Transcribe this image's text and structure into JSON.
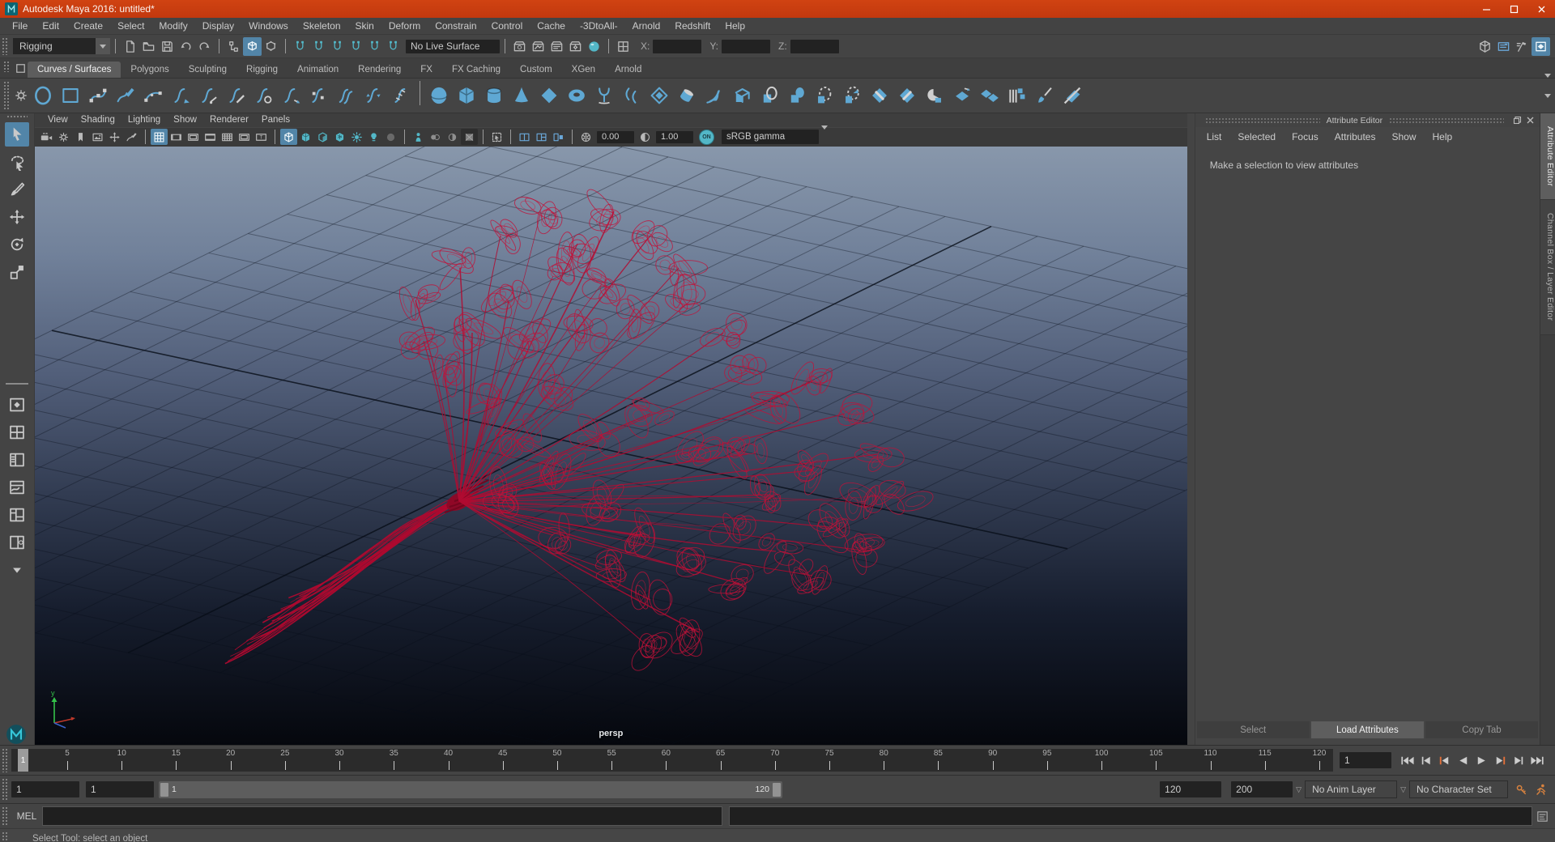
{
  "title_bar": {
    "title": "Autodesk Maya 2016: untitled*"
  },
  "menu_bar": {
    "items": [
      "File",
      "Edit",
      "Create",
      "Select",
      "Modify",
      "Display",
      "Windows",
      "Skeleton",
      "Skin",
      "Deform",
      "Constrain",
      "Control",
      "Cache",
      "-3DtoAll-",
      "Arnold",
      "Redshift",
      "Help"
    ]
  },
  "status_line": {
    "menuset_value": "Rigging",
    "live_surface_value": "No Live Surface",
    "x_label": "X:",
    "y_label": "Y:",
    "z_label": "Z:",
    "icons_file": [
      {
        "name": "new-scene-icon",
        "glyph": "file"
      },
      {
        "name": "open-scene-icon",
        "glyph": "folder"
      },
      {
        "name": "save-scene-icon",
        "glyph": "save"
      },
      {
        "name": "undo-icon",
        "glyph": "undo"
      },
      {
        "name": "redo-icon",
        "glyph": "redo"
      }
    ],
    "icons_selection": [
      {
        "name": "select-by-hierarchy-icon",
        "glyph": "selHier"
      },
      {
        "name": "select-by-object-type-icon",
        "glyph": "selObj",
        "active": true
      },
      {
        "name": "select-by-component-type-icon",
        "glyph": "selComp"
      }
    ],
    "icons_snap": [
      {
        "name": "snap-to-grid-icon",
        "glyph": "magnet",
        "tone": "teal"
      },
      {
        "name": "snap-to-curve-icon",
        "glyph": "magnet",
        "tone": "teal"
      },
      {
        "name": "snap-to-point-icon",
        "glyph": "magnet",
        "tone": "teal"
      },
      {
        "name": "snap-to-projected-center-icon",
        "glyph": "magnet",
        "tone": "teal"
      },
      {
        "name": "snap-to-view-plane-icon",
        "glyph": "magnet",
        "tone": "teal"
      },
      {
        "name": "make-object-live-icon",
        "glyph": "magnet",
        "tone": "teal"
      }
    ],
    "icons_render": [
      {
        "name": "open-render-view-icon",
        "glyph": "renderA"
      },
      {
        "name": "render-current-frame-icon",
        "glyph": "renderB"
      },
      {
        "name": "ipr-render-icon",
        "glyph": "renderC"
      },
      {
        "name": "render-settings-icon",
        "glyph": "renderD"
      },
      {
        "name": "display-render-settings-icon",
        "glyph": "tealSphere",
        "tone": "teal"
      }
    ],
    "icons_xyz": [
      {
        "name": "coordinate-input-mode-icon",
        "glyph": "xyzbox"
      }
    ],
    "icons_sidebar": [
      {
        "name": "modeling-toolkit-icon",
        "glyph": "cubeBig"
      },
      {
        "name": "humanik-icon",
        "glyph": "panelIcon",
        "tone": "blueline"
      },
      {
        "name": "tool-settings-icon",
        "glyph": "hammer"
      },
      {
        "name": "channel-box-icon",
        "glyph": "envelopeBox",
        "active": true
      }
    ]
  },
  "shelf": {
    "tabs": [
      {
        "label": "Curves / Surfaces",
        "active": true
      },
      {
        "label": "Polygons"
      },
      {
        "label": "Sculpting"
      },
      {
        "label": "Rigging"
      },
      {
        "label": "Animation"
      },
      {
        "label": "Rendering"
      },
      {
        "label": "FX"
      },
      {
        "label": "FX Caching"
      },
      {
        "label": "Custom"
      },
      {
        "label": "XGen"
      },
      {
        "label": "Arnold"
      }
    ],
    "icons": [
      {
        "name": "nurbs-circle-icon",
        "glyph": "shelfcircle"
      },
      {
        "name": "nurbs-square-icon",
        "glyph": "shelfsquare"
      },
      {
        "name": "cv-curve-tool-icon",
        "glyph": "cvcurve"
      },
      {
        "name": "pencil-curve-tool-icon",
        "glyph": "pencilcurve"
      },
      {
        "name": "three-point-arc-icon",
        "glyph": "arc3"
      },
      {
        "name": "attach-curves-icon",
        "glyph": "scurveA"
      },
      {
        "name": "detach-curves-icon",
        "glyph": "scurveCut"
      },
      {
        "name": "cut-curve-icon",
        "glyph": "scurveSlash"
      },
      {
        "name": "open-close-curve-icon",
        "glyph": "scurveO"
      },
      {
        "name": "extend-curve-icon",
        "glyph": "scurveArr"
      },
      {
        "name": "insert-knot-icon",
        "glyph": "scurvePts"
      },
      {
        "name": "offset-curve-icon",
        "glyph": "scurveDbl"
      },
      {
        "name": "reverse-curve-icon",
        "glyph": "scurveRev"
      },
      {
        "name": "rebuild-curve-icon",
        "glyph": "scurveHatch"
      },
      {
        "glyph": "|"
      },
      {
        "name": "nurbs-sphere-icon",
        "glyph": "sphereP"
      },
      {
        "name": "nurbs-cube-icon",
        "glyph": "cubeP"
      },
      {
        "name": "nurbs-cylinder-icon",
        "glyph": "cylP"
      },
      {
        "name": "nurbs-cone-icon",
        "glyph": "coneP"
      },
      {
        "name": "nurbs-plane-icon",
        "glyph": "planeP"
      },
      {
        "name": "nurbs-torus-icon",
        "glyph": "torusP"
      },
      {
        "name": "revolve-icon",
        "glyph": "revolveP"
      },
      {
        "name": "loft-icon",
        "glyph": "loftP"
      },
      {
        "name": "planar-icon",
        "glyph": "planarP"
      },
      {
        "name": "extrude-icon",
        "glyph": "tubeP"
      },
      {
        "name": "birail-icon",
        "glyph": "birailP"
      },
      {
        "name": "bevel-plus-icon",
        "glyph": "extrudeP"
      },
      {
        "name": "project-curve-icon",
        "glyph": "surfcirc1"
      },
      {
        "name": "intersect-surfaces-icon",
        "glyph": "surfcirc2"
      },
      {
        "name": "trim-tool-icon",
        "glyph": "projdash"
      },
      {
        "name": "untrim-surfaces-icon",
        "glyph": "projdash2"
      },
      {
        "name": "attach-surfaces-icon",
        "glyph": "trimdiamond"
      },
      {
        "name": "detach-surfaces-icon",
        "glyph": "trimdiamond2"
      },
      {
        "name": "open-close-surfaces-icon",
        "glyph": "pacmancyl"
      },
      {
        "name": "insert-isoparms-icon",
        "glyph": "arrowdiamond"
      },
      {
        "name": "extend-surfaces-icon",
        "glyph": "diamondpair"
      },
      {
        "name": "rebuild-surfaces-icon",
        "glyph": "barcubes"
      },
      {
        "name": "sculpt-surfaces-tool-icon",
        "glyph": "brushsurf"
      },
      {
        "name": "cut-surfaces-icon",
        "glyph": "slashdiamond"
      }
    ]
  },
  "toolbox": {
    "tools": [
      {
        "name": "select-tool-icon",
        "glyph": "cursor",
        "active": true
      },
      {
        "name": "lasso-select-tool-icon",
        "glyph": "lasso"
      },
      {
        "name": "paint-select-tool-icon",
        "glyph": "brush"
      },
      {
        "name": "move-tool-icon",
        "glyph": "move"
      },
      {
        "name": "rotate-tool-icon",
        "glyph": "rotate"
      },
      {
        "name": "scale-tool-icon",
        "glyph": "scale"
      }
    ],
    "layouts": [
      {
        "name": "layout-single-pane-icon",
        "glyph": "pane1"
      },
      {
        "name": "layout-four-pane-icon",
        "glyph": "pane4"
      },
      {
        "name": "layout-persp-outliner-icon",
        "glyph": "paneOutliner"
      },
      {
        "name": "layout-persp-graph-icon",
        "glyph": "paneGraph"
      },
      {
        "name": "layout-hypershade-icon",
        "glyph": "paneHyper"
      },
      {
        "name": "layout-persp-uv-icon",
        "glyph": "paneUV"
      },
      {
        "name": "layout-more-icon",
        "glyph": "dropdown"
      }
    ]
  },
  "viewport": {
    "menus": [
      "View",
      "Shading",
      "Lighting",
      "Show",
      "Renderer",
      "Panels"
    ],
    "toolbar": [
      {
        "name": "select-camera-icon",
        "glyph": "camera"
      },
      {
        "name": "camera-attributes-icon",
        "glyph": "gear"
      },
      {
        "name": "bookmark-icon",
        "glyph": "bookmark"
      },
      {
        "name": "image-plane-icon",
        "glyph": "imgplane"
      },
      {
        "name": "two-d-pan-zoom-icon",
        "glyph": "move"
      },
      {
        "name": "greasepencil-icon",
        "glyph": "pencilcurve"
      },
      {
        "glyph": "|"
      },
      {
        "name": "grid-toggle-icon",
        "glyph": "grid9",
        "active": true
      },
      {
        "name": "film-gate-icon",
        "glyph": "film"
      },
      {
        "name": "resolution-gate-icon",
        "glyph": "resgate"
      },
      {
        "name": "gate-mask-icon",
        "glyph": "gatemask"
      },
      {
        "name": "field-chart-icon",
        "glyph": "fieldchart"
      },
      {
        "name": "safe-action-icon",
        "glyph": "safeaction"
      },
      {
        "name": "safe-title-icon",
        "glyph": "safetitle"
      },
      {
        "glyph": "|"
      },
      {
        "name": "wireframe-display-icon",
        "glyph": "wirecube",
        "tone": "teal",
        "active": true
      },
      {
        "name": "shaded-display-icon",
        "glyph": "shadecube",
        "tone": "teal"
      },
      {
        "name": "wireframe-on-shaded-icon",
        "glyph": "halfcube",
        "tone": "teal"
      },
      {
        "name": "textured-display-icon",
        "glyph": "texcube",
        "tone": "teal"
      },
      {
        "name": "use-all-lights-icon",
        "glyph": "rays",
        "tone": "teal"
      },
      {
        "name": "shadows-icon",
        "glyph": "lightbulb",
        "tone": "teal"
      },
      {
        "name": "occlusion-icon",
        "glyph": "dimsphere",
        "tone": "dim"
      },
      {
        "glyph": "|"
      },
      {
        "name": "xray-icon",
        "glyph": "xrayperson",
        "tone": "teal"
      },
      {
        "name": "xray-joints-icon",
        "glyph": "circles3",
        "tone": "dim"
      },
      {
        "name": "exposure-contrast-icon",
        "glyph": "crescadow",
        "tone": "dim"
      },
      {
        "name": "texture-placement-icon",
        "glyph": "texsquare",
        "tone": "dim pressed"
      },
      {
        "glyph": "|"
      },
      {
        "name": "isolate-select-icon",
        "glyph": "isolatesel"
      },
      {
        "glyph": "|"
      },
      {
        "name": "pane-layout-icon",
        "glyph": "panedouble",
        "tone": "blueline"
      },
      {
        "name": "pane-layout-alt-icon",
        "glyph": "panecorner",
        "tone": "blueline"
      },
      {
        "name": "pane-pop-icon",
        "glyph": "paneswap",
        "tone": "blueline"
      },
      {
        "glyph": "|"
      },
      {
        "name": "exposure-icon",
        "glyph": "aperture"
      }
    ],
    "exposure_value": "0.00",
    "gamma_icon": "contrast-icon",
    "gamma_value": "1.00",
    "on_button": "ON",
    "color_transform": "sRGB gamma",
    "camera_label": "persp"
  },
  "attribute_editor": {
    "title": "Attribute Editor",
    "menus": [
      "List",
      "Selected",
      "Focus",
      "Attributes",
      "Show",
      "Help"
    ],
    "message": "Make a selection to view attributes",
    "buttons": [
      {
        "label": "Select"
      },
      {
        "label": "Load Attributes",
        "active": true
      },
      {
        "label": "Copy Tab"
      }
    ]
  },
  "side_tabs": [
    {
      "label": "Attribute Editor",
      "active": true
    },
    {
      "label": "Channel Box / Layer Editor"
    }
  ],
  "timeline": {
    "ticks": [
      5,
      10,
      15,
      20,
      25,
      30,
      35,
      40,
      45,
      50,
      55,
      60,
      65,
      70,
      75,
      80,
      85,
      90,
      95,
      100,
      105,
      110,
      115,
      120
    ],
    "current_frame": "1",
    "time_field": "1",
    "playback": [
      {
        "name": "go-to-start-button",
        "glyph": "pbStart"
      },
      {
        "name": "step-back-key-button",
        "glyph": "pbPrevKey"
      },
      {
        "name": "step-back-frame-button",
        "glyph": "pbPrevFrame"
      },
      {
        "name": "play-backwards-button",
        "glyph": "pbPlayBack"
      },
      {
        "name": "play-forwards-button",
        "glyph": "pbPlay"
      },
      {
        "name": "step-forward-frame-button",
        "glyph": "pbNextFrame"
      },
      {
        "name": "step-forward-key-button",
        "glyph": "pbNextKey"
      },
      {
        "name": "go-to-end-button",
        "glyph": "pbEnd"
      }
    ]
  },
  "range_slider": {
    "animation_start": "1",
    "playback_start": "1",
    "range_start_label": "1",
    "range_end_label": "120",
    "playback_end": "120",
    "animation_end": "200",
    "anim_layer": "No Anim Layer",
    "character_set": "No Character Set",
    "icons": [
      {
        "name": "auto-keyframe-icon",
        "glyph": "autokey"
      },
      {
        "name": "animation-preferences-icon",
        "glyph": "animprefs"
      }
    ]
  },
  "command_line": {
    "label": "MEL"
  },
  "help_line": {
    "text": "Select Tool: select an object"
  },
  "colors": {
    "titlebar": "#c93c10",
    "accent_teal": "#53b7c7",
    "shelf_blue": "#5fa8d3",
    "wireframe_red": "#c21038",
    "active_blue": "#5285a8"
  }
}
